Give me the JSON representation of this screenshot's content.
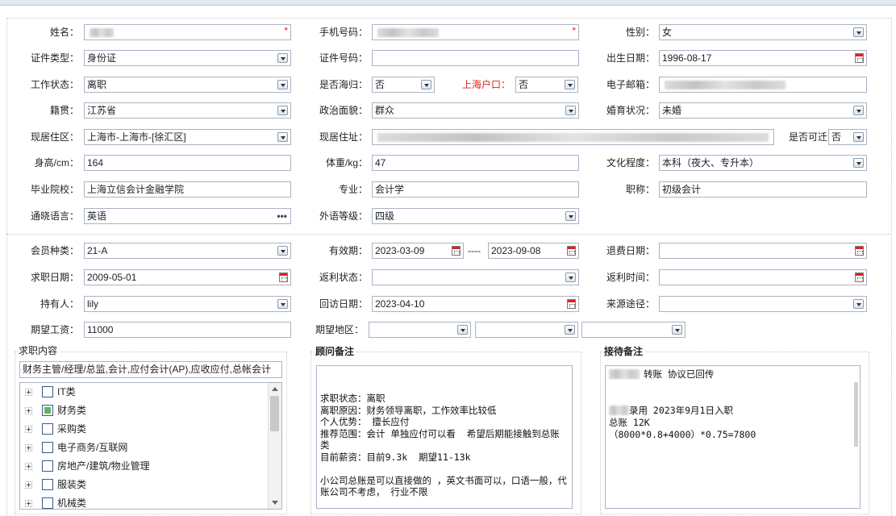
{
  "personal": {
    "name": {
      "label": "姓名："
    },
    "mobile": {
      "label": "手机号码："
    },
    "gender": {
      "label": "性别：",
      "value": "女"
    },
    "id_type": {
      "label": "证件类型：",
      "value": "身份证"
    },
    "id_number": {
      "label": "证件号码：",
      "value": ""
    },
    "birth_date": {
      "label": "出生日期：",
      "value": "1996-08-17"
    },
    "work_status": {
      "label": "工作状态：",
      "value": "离职"
    },
    "returnee": {
      "label": "是否海归：",
      "value": "否"
    },
    "shanghai_hukou": {
      "label": "上海户口：",
      "value": "否"
    },
    "email": {
      "label": "电子邮箱："
    },
    "native_place": {
      "label": "籍贯：",
      "value": "江苏省"
    },
    "political_status": {
      "label": "政治面貌：",
      "value": "群众"
    },
    "marital_status": {
      "label": "婚育状况：",
      "value": "未婚"
    },
    "residence_area": {
      "label": "现居住区：",
      "value": "上海市-上海市-[徐汇区]"
    },
    "residence_address": {
      "label": "现居住址："
    },
    "can_relocate": {
      "label": "是否可迁",
      "value": "否"
    },
    "height": {
      "label": "身高/cm：",
      "value": "164"
    },
    "weight": {
      "label": "体重/kg：",
      "value": "47"
    },
    "education": {
      "label": "文化程度：",
      "value": "本科（夜大、专升本）"
    },
    "school": {
      "label": "毕业院校：",
      "value": "上海立信会计金融学院"
    },
    "major": {
      "label": "专业：",
      "value": "会计学"
    },
    "title": {
      "label": "职称：",
      "value": "初级会计"
    },
    "languages": {
      "label": "通晓语言：",
      "value": "英语",
      "more": "•••"
    },
    "foreign_level": {
      "label": "外语等级：",
      "value": "四级"
    },
    "required_mark": "*"
  },
  "membership": {
    "member_type": {
      "label": "会员种类：",
      "value": "21-A"
    },
    "validity": {
      "label": "有效期：",
      "from": "2023-03-09",
      "separator": "----",
      "to": "2023-09-08"
    },
    "refund_date": {
      "label": "退费日期：",
      "value": ""
    },
    "job_seek_date": {
      "label": "求职日期：",
      "value": "2009-05-01"
    },
    "rebate_status": {
      "label": "返利状态：",
      "value": ""
    },
    "rebate_time": {
      "label": "返利时间：",
      "value": ""
    },
    "holder": {
      "label": "持有人：",
      "value": "lily"
    },
    "revisit_date": {
      "label": "回访日期：",
      "value": "2023-04-10"
    },
    "source": {
      "label": "来源途径：",
      "value": ""
    },
    "expected_salary": {
      "label": "期望工资：",
      "value": "11000"
    },
    "expected_region": {
      "label": "期望地区：",
      "values": [
        "",
        "",
        ""
      ]
    }
  },
  "job_content": {
    "title": "求职内容",
    "summary": "财务主管/经理/总监,会计,应付会计(AP),应收应付,总帐会计",
    "categories": [
      {
        "label": "IT类",
        "checked": false
      },
      {
        "label": "财务类",
        "checked": true
      },
      {
        "label": "采购类",
        "checked": false
      },
      {
        "label": "电子商务/互联网",
        "checked": false
      },
      {
        "label": "房地产/建筑/物业管理",
        "checked": false
      },
      {
        "label": "服装类",
        "checked": false
      },
      {
        "label": "机械类",
        "checked": false
      }
    ]
  },
  "consultant_notes": {
    "title": "顾问备注",
    "text": "\n\n求职状态：离职\n离职原因：财务领导离职，工作效率比较低\n个人优势： 擅长应付\n推荐范围：会计 单独应付可以看  希望后期能接触到总账类\n目前薪资：目前9.3k  期望11-13k\n\n小公司总账是可以直接做的 ，英文书面可以，口语一般，代账公司不考虑， 行业不限"
  },
  "reception_notes": {
    "title": "接待备注",
    "line1": "转账 协议已回传",
    "line2": "录用 2023年9月1日入职",
    "line3": "总账 12K",
    "line4": "（8000*0.8+4000）*0.75=7800"
  }
}
